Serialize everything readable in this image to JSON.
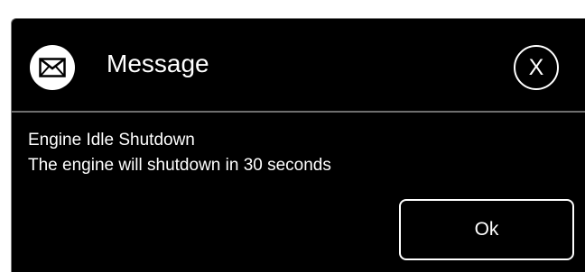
{
  "dialog": {
    "icon": "envelope-icon",
    "title": "Message",
    "close_label": "X",
    "message_heading": "Engine Idle Shutdown",
    "message_text": "The engine will shutdown in 30 seconds",
    "ok_label": "Ok"
  },
  "colors": {
    "background": "#000000",
    "text": "#ffffff",
    "divider": "#6e6e6e",
    "page": "#ffffff"
  }
}
